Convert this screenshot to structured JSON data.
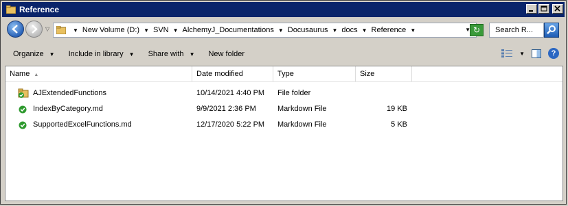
{
  "window": {
    "title": "Reference"
  },
  "address": {
    "crumbs": [
      "New Volume (D:)",
      "SVN",
      "AlchemyJ_Documentations",
      "Docusaurus",
      "docs",
      "Reference"
    ]
  },
  "search": {
    "placeholder": "Search R..."
  },
  "toolbar": {
    "organize_label": "Organize",
    "include_label": "Include in library",
    "share_label": "Share with",
    "new_folder_label": "New folder"
  },
  "columns": {
    "name": "Name",
    "date": "Date modified",
    "type": "Type",
    "size": "Size"
  },
  "files": [
    {
      "name": "AJExtendedFunctions",
      "date": "10/14/2021 4:40 PM",
      "type": "File folder",
      "size": "",
      "icon": "folder-synced-icon"
    },
    {
      "name": "IndexByCategory.md",
      "date": "9/9/2021 2:36 PM",
      "type": "Markdown File",
      "size": "19 KB",
      "icon": "file-synced-icon"
    },
    {
      "name": "SupportedExcelFunctions.md",
      "date": "12/17/2020 5:22 PM",
      "type": "Markdown File",
      "size": "5 KB",
      "icon": "file-synced-icon"
    }
  ],
  "colors": {
    "titlebar": "#0a246a",
    "sync_green": "#2f9a2f",
    "window_bg": "#d4d0c8"
  }
}
